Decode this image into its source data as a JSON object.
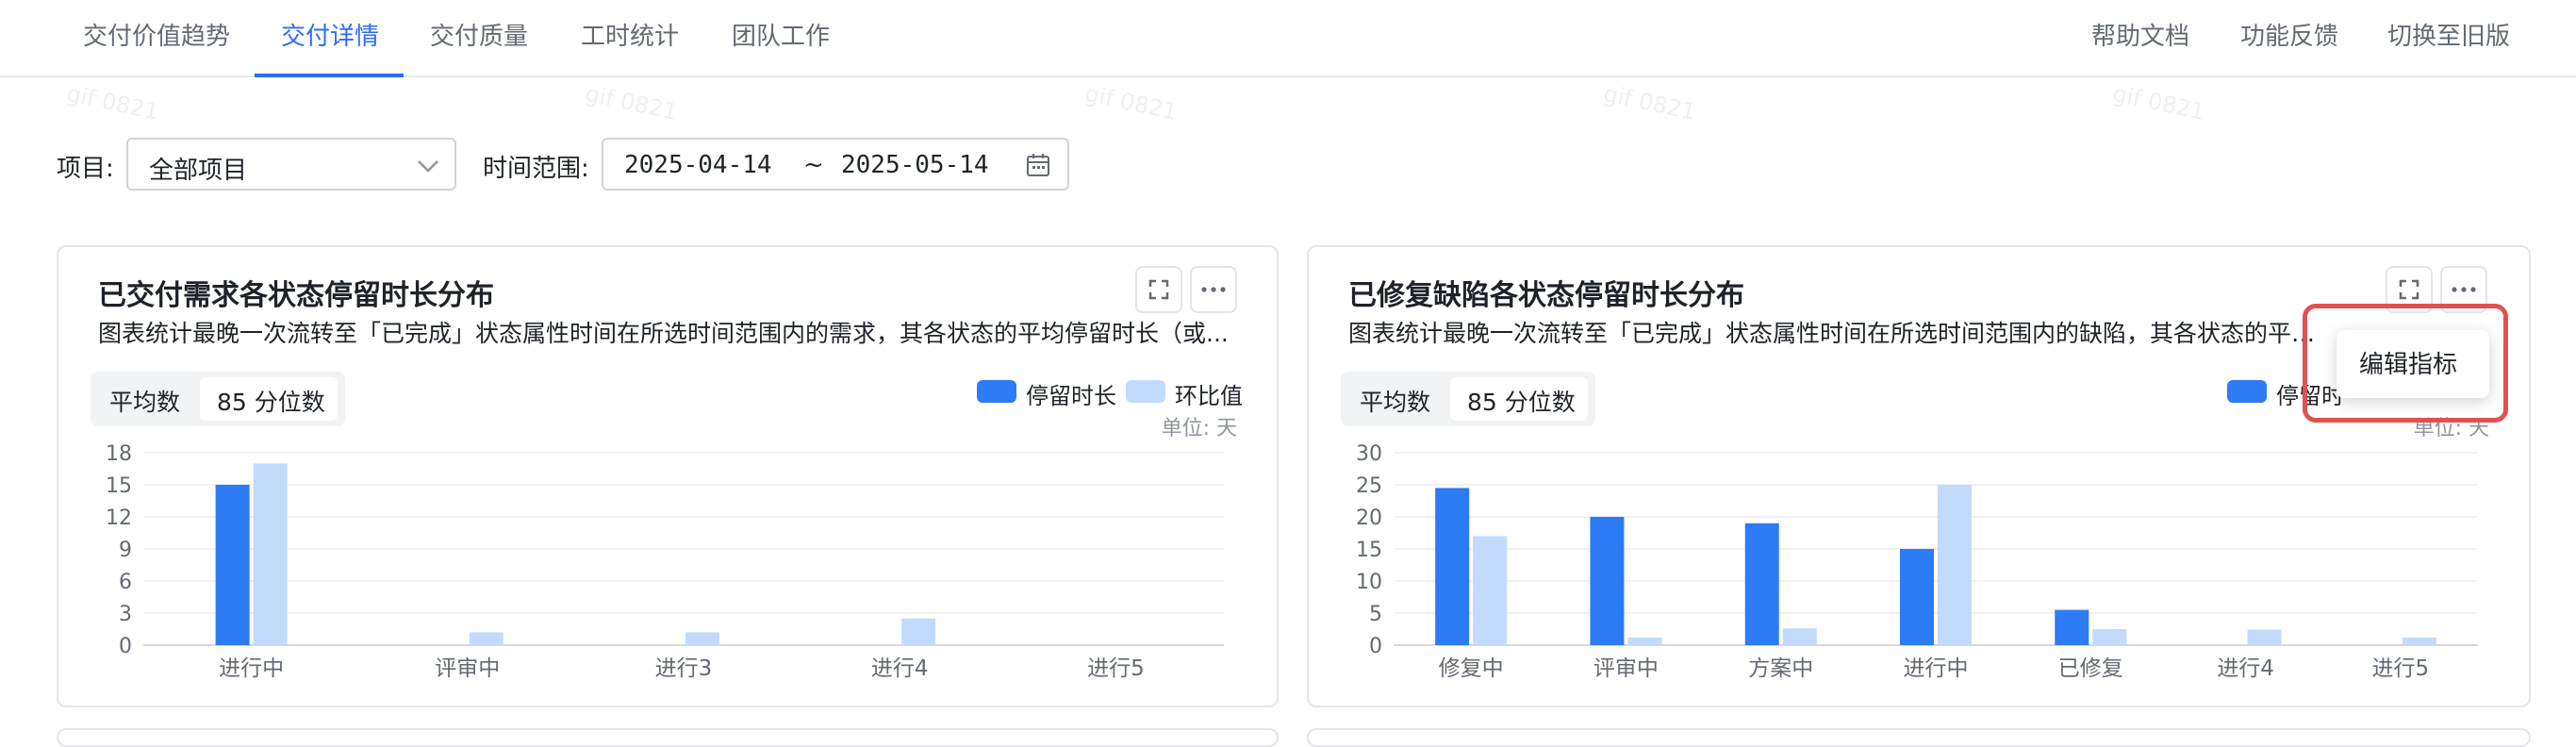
{
  "nav": {
    "tabs": [
      "交付价值趋势",
      "交付详情",
      "交付质量",
      "工时统计",
      "团队工作"
    ],
    "active_tab": "交付详情",
    "right_links": [
      "帮助文档",
      "功能反馈",
      "切换至旧版"
    ]
  },
  "watermark": "gif 0821",
  "filters": {
    "project_label": "项目:",
    "project_value": "全部项目",
    "time_label": "时间范围:",
    "date_start": "2025-04-14",
    "date_sep": "~",
    "date_end": "2025-05-14"
  },
  "cards": [
    {
      "title": "已交付需求各状态停留时长分布",
      "desc": "图表统计最晚一次流转至「已完成」状态属性时间在所选时间范围内的需求，其各状态的平均停留时长（或...",
      "toggle": [
        "平均数",
        "85 分位数"
      ],
      "legend": [
        "停留时长",
        "环比值"
      ],
      "unit": "单位: 天"
    },
    {
      "title": "已修复缺陷各状态停留时长分布",
      "desc": "图表统计最晚一次流转至「已完成」状态属性时间在所选时间范围内的缺陷，其各状态的平均停留时长",
      "toggle": [
        "平均数",
        "85 分位数"
      ],
      "legend": [
        "停留时"
      ],
      "unit": "单位: 天"
    }
  ],
  "popup_menu": {
    "item": "编辑指标"
  },
  "colors": {
    "primary": "#2d7bf5",
    "secondary": "#c3dbfb",
    "accent": "#2d6cf6",
    "highlight": "#e05252"
  },
  "chart_data": [
    {
      "type": "bar",
      "categories": [
        "进行中",
        "评审中",
        "进行3",
        "进行4",
        "进行5"
      ],
      "series": [
        {
          "name": "停留时长",
          "values": [
            15,
            0,
            0,
            0,
            0
          ]
        },
        {
          "name": "环比值",
          "values": [
            17,
            1.2,
            1.2,
            2.5,
            0
          ]
        }
      ],
      "yticks": [
        0,
        3,
        6,
        9,
        12,
        15,
        18
      ],
      "ylim": [
        0,
        18
      ],
      "grid": true,
      "legend_position": "top-right"
    },
    {
      "type": "bar",
      "categories": [
        "修复中",
        "评审中",
        "方案中",
        "进行中",
        "已修复",
        "进行4",
        "进行5"
      ],
      "series": [
        {
          "name": "停留时",
          "values": [
            24.5,
            20,
            19,
            15,
            5.5,
            0,
            0
          ]
        },
        {
          "values": [
            17,
            1.2,
            2.6,
            25,
            2.5,
            2.4,
            1.2
          ]
        }
      ],
      "yticks": [
        0,
        5,
        10,
        15,
        20,
        25,
        30
      ],
      "ylim": [
        0,
        30
      ],
      "grid": true,
      "legend_position": "top-right"
    }
  ]
}
